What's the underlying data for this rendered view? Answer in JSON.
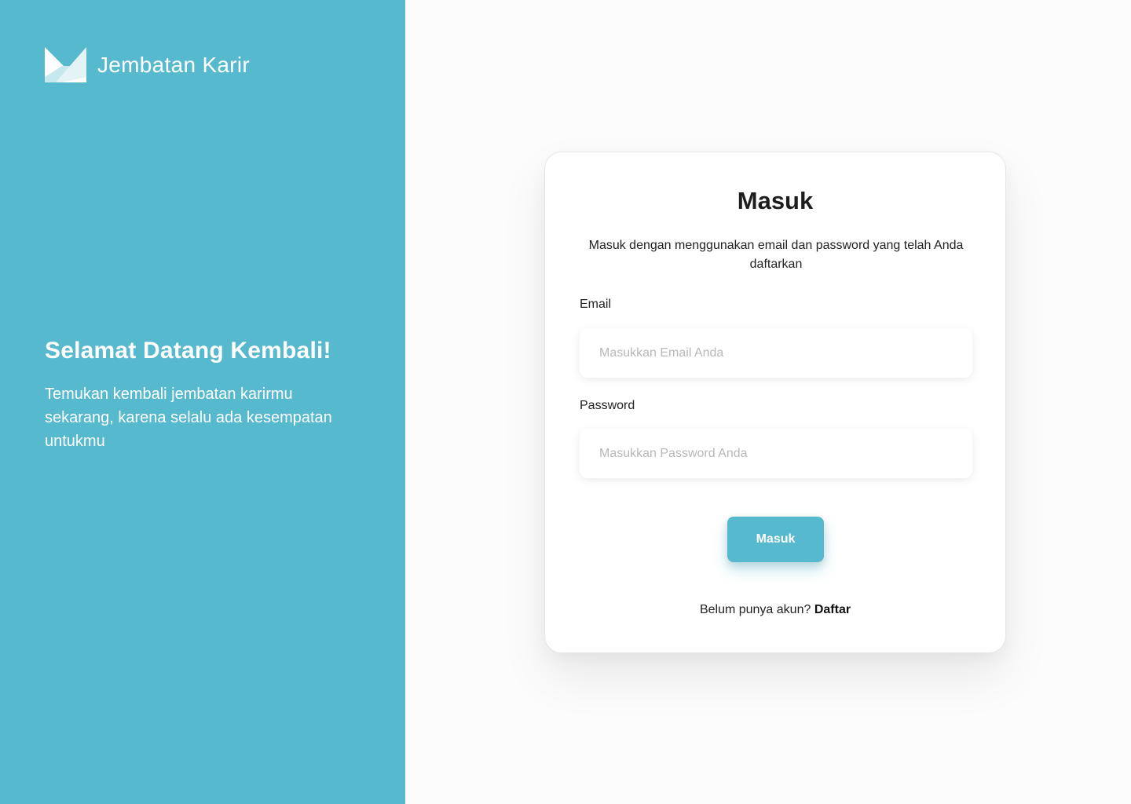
{
  "brand": {
    "name": "Jembatan Karir",
    "logo_icon": "jembatan-karir-logo"
  },
  "welcome": {
    "title": "Selamat Datang Kembali!",
    "text": "Temukan kembali jembatan karirmu sekarang, karena selalu ada kesempatan untukmu"
  },
  "login": {
    "title": "Masuk",
    "description": "Masuk dengan menggunakan email dan password yang telah Anda daftarkan",
    "email": {
      "label": "Email",
      "placeholder": "Masukkan Email Anda",
      "value": ""
    },
    "password": {
      "label": "Password",
      "placeholder": "Masukkan Password Anda",
      "value": ""
    },
    "submit_label": "Masuk",
    "register_prompt": "Belum punya akun?",
    "register_link": "Daftar"
  },
  "colors": {
    "accent": "#56b9cd",
    "background": "#fcfcfc",
    "card": "#ffffff",
    "text": "#222222"
  }
}
